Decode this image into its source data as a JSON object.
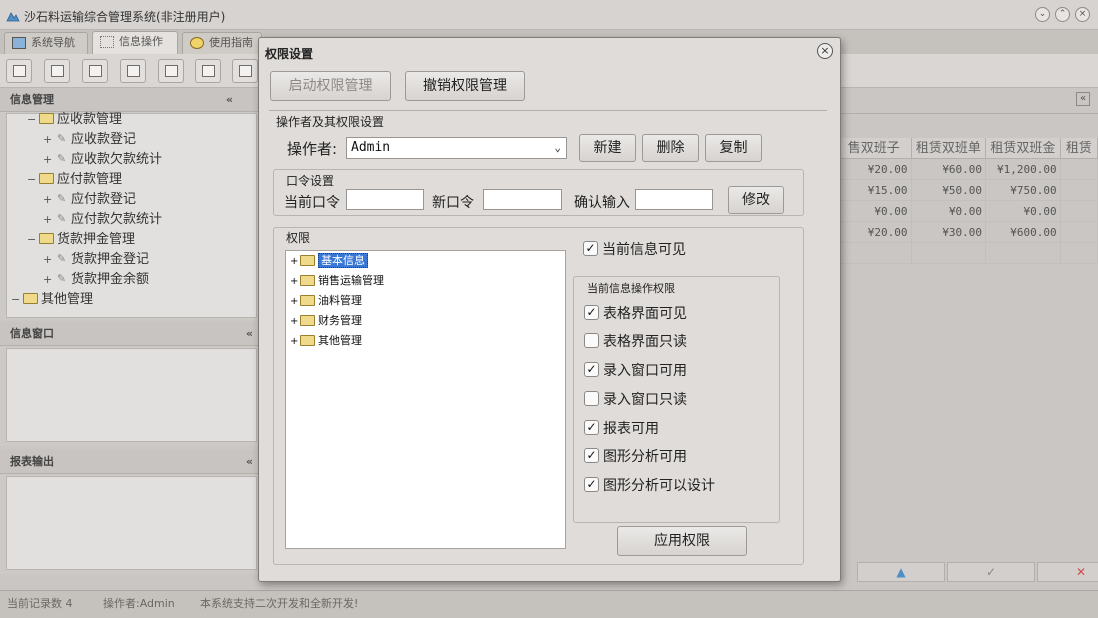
{
  "app": {
    "title": "沙石料运输综合管理系统(非注册用户)",
    "window_buttons": [
      "⌄",
      "⌃",
      "×"
    ]
  },
  "main_tabs": [
    {
      "label": "系统导航",
      "icon": "monitor-icon"
    },
    {
      "label": "信息操作",
      "icon": "grid-icon"
    },
    {
      "label": "使用指南",
      "icon": "compass-icon"
    }
  ],
  "left_panels": {
    "info_manage": {
      "title": "信息管理",
      "collapse": "«",
      "tree": [
        {
          "label": "应收款管理",
          "type": "folder",
          "exp": "−",
          "indent": 1
        },
        {
          "label": "应收款登记",
          "type": "leaf",
          "exp": "+",
          "indent": 2
        },
        {
          "label": "应收款欠款统计",
          "type": "leaf",
          "exp": "+",
          "indent": 2
        },
        {
          "label": "应付款管理",
          "type": "folder",
          "exp": "−",
          "indent": 1
        },
        {
          "label": "应付款登记",
          "type": "leaf",
          "exp": "+",
          "indent": 2
        },
        {
          "label": "应付款欠款统计",
          "type": "leaf",
          "exp": "+",
          "indent": 2
        },
        {
          "label": "货款押金管理",
          "type": "folder",
          "exp": "−",
          "indent": 1
        },
        {
          "label": "货款押金登记",
          "type": "leaf",
          "exp": "+",
          "indent": 2
        },
        {
          "label": "货款押金余额",
          "type": "leaf",
          "exp": "+",
          "indent": 2
        },
        {
          "label": "其他管理",
          "type": "folder",
          "exp": "−",
          "indent": 0
        }
      ]
    },
    "info_window": {
      "title": "信息窗口",
      "collapse": "«"
    },
    "report_output": {
      "title": "报表输出",
      "collapse": "«"
    }
  },
  "grid": {
    "headers": [
      "售双班子",
      "租赁双班单",
      "租赁双班金",
      "租赁"
    ],
    "rows": [
      [
        "¥20.00",
        "¥60.00",
        "¥1,200.00"
      ],
      [
        "¥15.00",
        "¥50.00",
        "¥750.00"
      ],
      [
        "¥0.00",
        "¥0.00",
        "¥0.00"
      ],
      [
        "¥20.00",
        "¥30.00",
        "¥600.00"
      ]
    ],
    "nav_buttons": [
      "▲",
      "✓",
      "✕"
    ]
  },
  "statusbar": {
    "record_count": "当前记录数 4",
    "operator": "操作者:Admin",
    "message": "本系统支持二次开发和全新开发!"
  },
  "dialog": {
    "title": "权限设置",
    "close": "×",
    "enable_btn": "启动权限管理",
    "revoke_btn": "撤销权限管理",
    "operator_group": {
      "title": "操作者及其权限设置",
      "operator_label": "操作者:",
      "operator_value": "Admin",
      "new_btn": "新建",
      "delete_btn": "删除",
      "copy_btn": "复制"
    },
    "password_group": {
      "title": "口令设置",
      "current_label": "当前口令",
      "new_label": "新口令",
      "confirm_label": "确认输入",
      "modify_btn": "修改"
    },
    "perm_group": {
      "title": "权限",
      "tree": [
        "基本信息",
        "销售运输管理",
        "油料管理",
        "财务管理",
        "其他管理"
      ],
      "selected_index": 0,
      "current_visible_label": "当前信息可见",
      "current_visible": true,
      "ops_title": "当前信息操作权限",
      "ops": [
        {
          "label": "表格界面可见",
          "checked": true
        },
        {
          "label": "表格界面只读",
          "checked": false
        },
        {
          "label": "录入窗口可用",
          "checked": true
        },
        {
          "label": "录入窗口只读",
          "checked": false
        },
        {
          "label": "报表可用",
          "checked": true
        },
        {
          "label": "图形分析可用",
          "checked": true
        },
        {
          "label": "图形分析可以设计",
          "checked": true
        }
      ],
      "apply_btn": "应用权限"
    }
  }
}
